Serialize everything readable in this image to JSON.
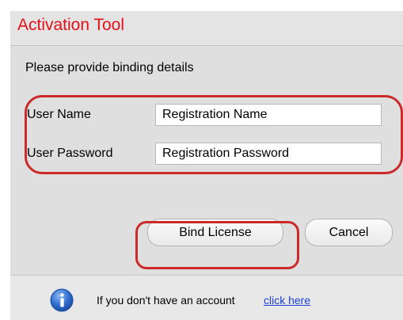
{
  "dialog": {
    "title": "Activation Tool"
  },
  "form": {
    "prompt": "Please provide binding details",
    "username_label": "User Name",
    "username_value": "Registration Name",
    "password_label": "User Password",
    "password_value": "Registration Password"
  },
  "buttons": {
    "bind_label": "Bind License",
    "cancel_label": "Cancel"
  },
  "footer": {
    "icon": "info-icon",
    "message": "If you don't have an account",
    "link_text": "click here"
  },
  "colors": {
    "title": "#e4101a",
    "annotation": "#cc2a2a",
    "link": "#1b3fd6",
    "info_icon": "#2f6fd0"
  }
}
